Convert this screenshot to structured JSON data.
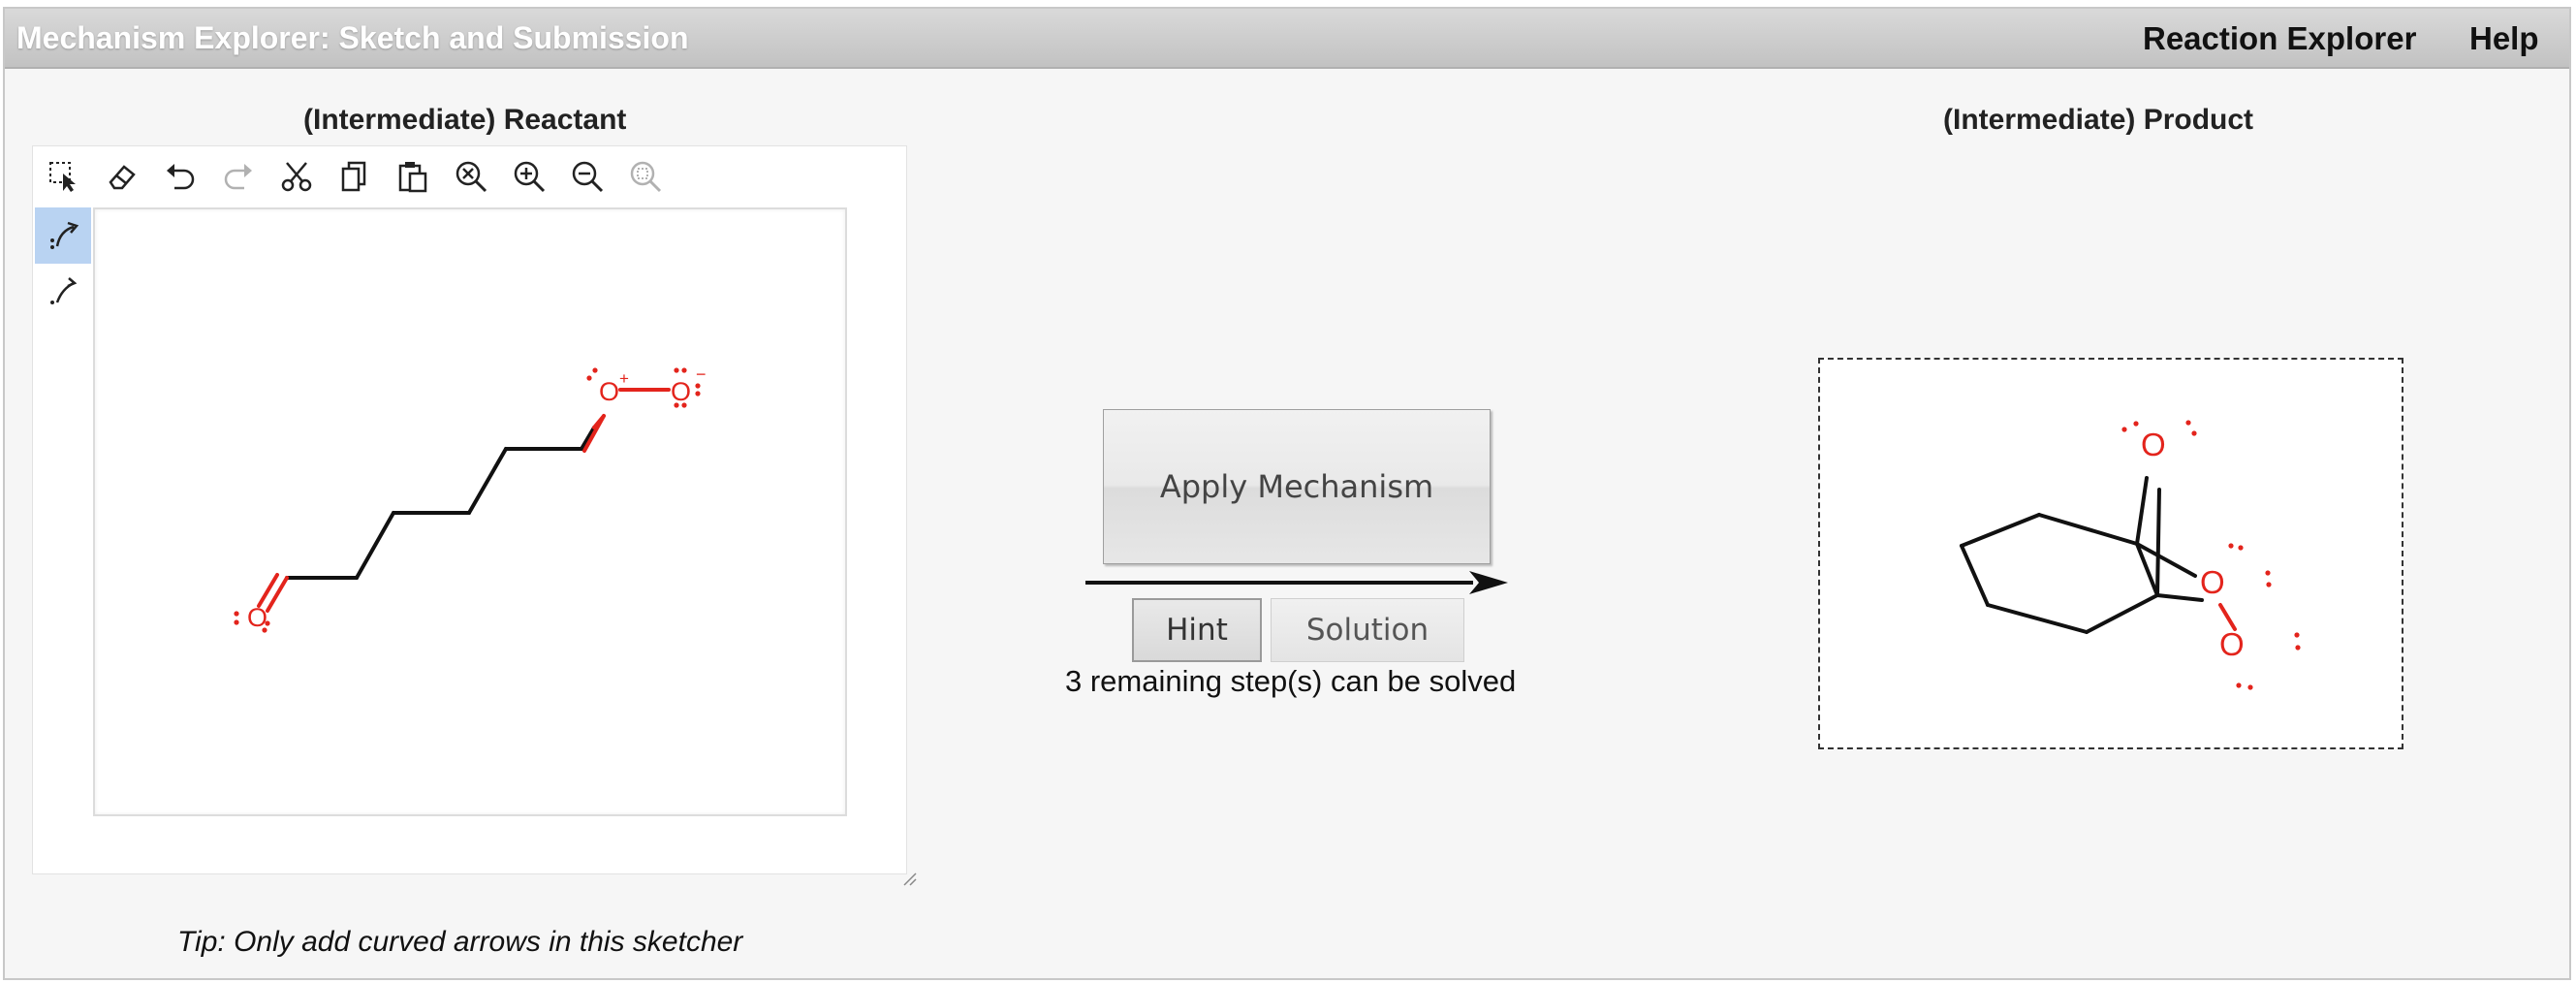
{
  "header": {
    "app_title": "Mechanism Explorer: Sketch and Submission",
    "nav": [
      "Reaction Explorer",
      "Help"
    ]
  },
  "reactant": {
    "heading": "(Intermediate) Reactant",
    "toolbar_tools": [
      "select-icon",
      "eraser-icon",
      "undo-icon",
      "redo-icon",
      "cut-icon",
      "copy-icon",
      "paste-icon",
      "clear-icon",
      "zoom-in-icon",
      "zoom-out-icon",
      "zoom-reset-icon"
    ],
    "arrow_tools": [
      {
        "name": "electron-pair-arrow-icon",
        "active": true
      },
      {
        "name": "single-electron-arrow-icon",
        "active": false
      }
    ],
    "atoms": {
      "carbonyl_o": "O",
      "ozonide_o_center": "O",
      "ozonide_o_terminal": "O",
      "plus_charge": "+",
      "minus_charge": "−"
    },
    "tip": "Tip: Only add curved arrows in this sketcher"
  },
  "controls": {
    "apply_label": "Apply Mechanism",
    "hint_label": "Hint",
    "solution_label": "Solution",
    "steps_text": "3 remaining step(s) can be solved"
  },
  "product": {
    "heading": "(Intermediate) Product",
    "atoms": [
      "O",
      "O",
      "O"
    ]
  },
  "colors": {
    "atom_red": "#e3241c",
    "bond": "#111111",
    "active_tool": "#b9d3f2"
  }
}
